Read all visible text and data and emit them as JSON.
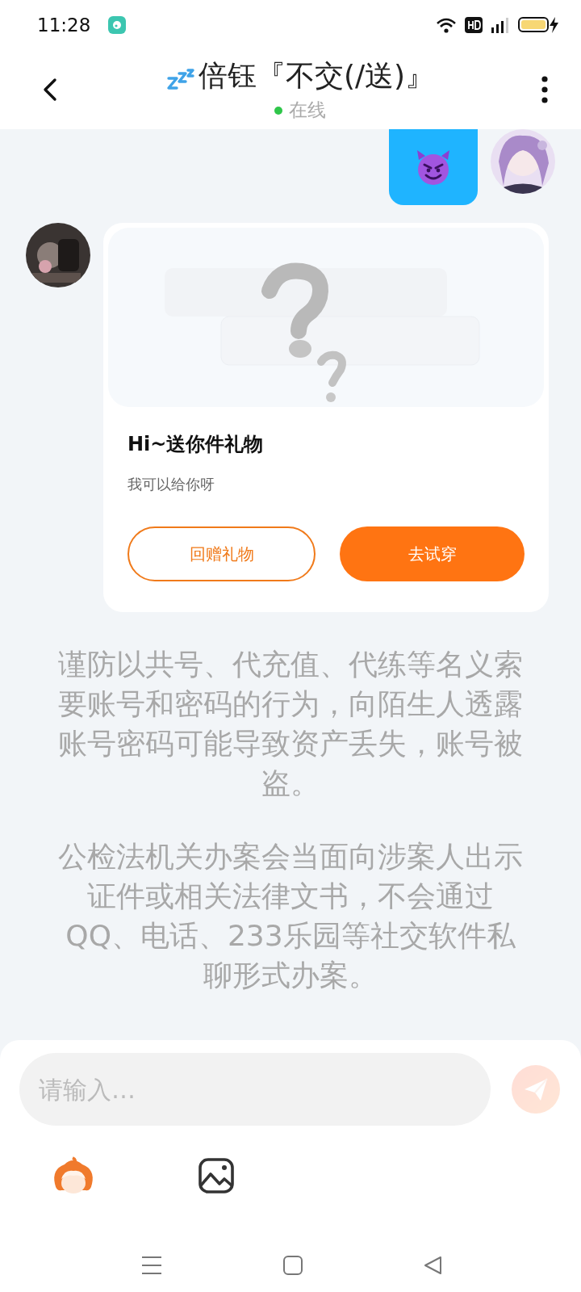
{
  "status_bar": {
    "time": "11:28"
  },
  "header": {
    "title": "倍钰『不交(/送)』",
    "presence": "在线",
    "online": true
  },
  "messages": [
    {
      "kind": "sticker",
      "outgoing": true
    },
    {
      "kind": "gift_card",
      "outgoing": false,
      "title": "Hi~送你件礼物",
      "subtitle": "我可以给你呀",
      "buttons": [
        {
          "label": "回赠礼物",
          "kind": "outline"
        },
        {
          "label": "去试穿",
          "kind": "filled"
        }
      ]
    }
  ],
  "notices": [
    "谨防以共号、代充值、代练等名义索要账号和密码的行为，向陌生人透露账号密码可能导致资产丢失，账号被盗。",
    "公检法机关办案会当面向涉案人出示证件或相关法律文书，不会通过QQ、电话、233乐园等社交软件私聊形式办案。"
  ],
  "composer": {
    "placeholder": "请输入…",
    "send_disabled": true
  }
}
